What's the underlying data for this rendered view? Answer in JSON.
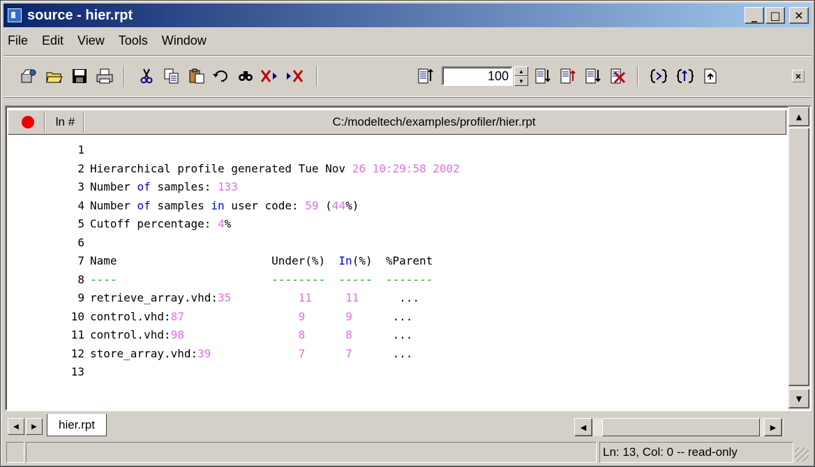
{
  "window": {
    "title": "source - hier.rpt",
    "controls": [
      "_",
      "□",
      "✕"
    ]
  },
  "menu": [
    "File",
    "Edit",
    "View",
    "Tools",
    "Window"
  ],
  "toolbar": {
    "zoom_value": "100",
    "icons": [
      "open-project-icon",
      "open-folder-icon",
      "save-icon",
      "print-icon",
      "cut-icon",
      "copy-icon",
      "paste-icon",
      "undo-icon",
      "find-icon",
      "clear-bookmark-icon",
      "next-bookmark-icon",
      "goto-line-icon",
      "zoom-spinner",
      "bookmark-icons",
      "compile-icon",
      "simulate-icon",
      "new-doc-icon",
      "close-icon"
    ]
  },
  "editor": {
    "breakpoint_col": "",
    "linenum_col": "ln #",
    "file_path": "C:/modeltech/examples/profiler/hier.rpt",
    "lines": [
      {
        "n": "1",
        "segs": []
      },
      {
        "n": "2",
        "segs": [
          {
            "t": "Hierarchical profile generated Tue Nov ",
            "c": "plain"
          },
          {
            "t": "26 10:29:58 2002",
            "c": "num"
          }
        ]
      },
      {
        "n": "3",
        "segs": [
          {
            "t": "Number ",
            "c": "plain"
          },
          {
            "t": "of",
            "c": "kw"
          },
          {
            "t": " samples: ",
            "c": "plain"
          },
          {
            "t": "133",
            "c": "num"
          }
        ]
      },
      {
        "n": "4",
        "segs": [
          {
            "t": "Number ",
            "c": "plain"
          },
          {
            "t": "of",
            "c": "kw"
          },
          {
            "t": " samples ",
            "c": "plain"
          },
          {
            "t": "in",
            "c": "kw"
          },
          {
            "t": " user code: ",
            "c": "plain"
          },
          {
            "t": "59",
            "c": "num"
          },
          {
            "t": " (",
            "c": "plain"
          },
          {
            "t": "44",
            "c": "num"
          },
          {
            "t": "%)",
            "c": "plain"
          }
        ]
      },
      {
        "n": "5",
        "segs": [
          {
            "t": "Cutoff percentage: ",
            "c": "plain"
          },
          {
            "t": "4",
            "c": "num"
          },
          {
            "t": "%",
            "c": "plain"
          }
        ]
      },
      {
        "n": "6",
        "segs": []
      },
      {
        "n": "7",
        "segs": [
          {
            "t": "Name                       Under(%)  ",
            "c": "plain"
          },
          {
            "t": "In",
            "c": "kw"
          },
          {
            "t": "(%)  %Parent",
            "c": "plain"
          }
        ]
      },
      {
        "n": "8",
        "segs": [
          {
            "t": "----                       --------  -----  -------",
            "c": "dash"
          }
        ]
      },
      {
        "n": "9",
        "segs": [
          {
            "t": "retrieve_array.vhd:",
            "c": "plain"
          },
          {
            "t": "35",
            "c": "num"
          },
          {
            "t": "          ",
            "c": "plain"
          },
          {
            "t": "11",
            "c": "num"
          },
          {
            "t": "     ",
            "c": "plain"
          },
          {
            "t": "11",
            "c": "num"
          },
          {
            "t": "      ...",
            "c": "plain"
          }
        ]
      },
      {
        "n": "10",
        "segs": [
          {
            "t": "control.vhd:",
            "c": "plain"
          },
          {
            "t": "87",
            "c": "num"
          },
          {
            "t": "                 ",
            "c": "plain"
          },
          {
            "t": "9",
            "c": "num"
          },
          {
            "t": "      ",
            "c": "plain"
          },
          {
            "t": "9",
            "c": "num"
          },
          {
            "t": "      ...",
            "c": "plain"
          }
        ]
      },
      {
        "n": "11",
        "segs": [
          {
            "t": "control.vhd:",
            "c": "plain"
          },
          {
            "t": "98",
            "c": "num"
          },
          {
            "t": "                 ",
            "c": "plain"
          },
          {
            "t": "8",
            "c": "num"
          },
          {
            "t": "      ",
            "c": "plain"
          },
          {
            "t": "8",
            "c": "num"
          },
          {
            "t": "      ...",
            "c": "plain"
          }
        ]
      },
      {
        "n": "12",
        "segs": [
          {
            "t": "store_array.vhd:",
            "c": "plain"
          },
          {
            "t": "39",
            "c": "num"
          },
          {
            "t": "             ",
            "c": "plain"
          },
          {
            "t": "7",
            "c": "num"
          },
          {
            "t": "      ",
            "c": "plain"
          },
          {
            "t": "7",
            "c": "num"
          },
          {
            "t": "      ...",
            "c": "plain"
          }
        ]
      },
      {
        "n": "13",
        "segs": []
      }
    ]
  },
  "tabs": [
    "hier.rpt"
  ],
  "status": {
    "left": "",
    "middle": "",
    "right": "Ln:  13, Col:  0  -- read-only"
  },
  "colors": {
    "keyword": "#0000dd",
    "number": "#e070e0",
    "dashes": "#00aa00",
    "breakpoint": "#ee0000"
  }
}
